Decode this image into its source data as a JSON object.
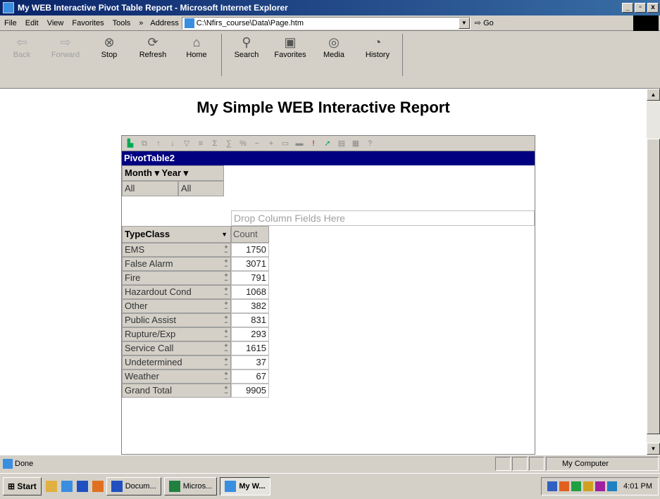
{
  "window": {
    "title": "My WEB Interactive Pivot Table Report - Microsoft Internet Explorer",
    "controls": [
      "_",
      "▫",
      "x"
    ]
  },
  "menu": {
    "items": [
      "File",
      "Edit",
      "View",
      "Favorites",
      "Tools"
    ],
    "more": "»",
    "address_label": "Address",
    "address_value": "C:\\Nfirs_course\\Data\\Page.htm",
    "go_label": "Go"
  },
  "toolbar": {
    "buttons": [
      {
        "label": "Back",
        "icon": "back-arrow-icon",
        "enabled": false
      },
      {
        "label": "Forward",
        "icon": "forward-arrow-icon",
        "enabled": false
      },
      {
        "label": "Stop",
        "icon": "stop-icon",
        "enabled": true
      },
      {
        "label": "Refresh",
        "icon": "refresh-icon",
        "enabled": true
      },
      {
        "label": "Home",
        "icon": "home-icon",
        "enabled": true
      },
      {
        "label": "Search",
        "icon": "search-icon",
        "enabled": true
      },
      {
        "label": "Favorites",
        "icon": "favorites-icon",
        "enabled": true
      },
      {
        "label": "Media",
        "icon": "media-icon",
        "enabled": true
      },
      {
        "label": "History",
        "icon": "history-icon",
        "enabled": true
      }
    ]
  },
  "page": {
    "title": "My Simple WEB Interactive Report"
  },
  "pivot": {
    "name": "PivotTable2",
    "filters": [
      {
        "field": "Month",
        "value": "All"
      },
      {
        "field": "Year",
        "value": "All"
      }
    ],
    "drop_column_hint": "Drop Column Fields Here",
    "row_field": "TypeClass",
    "data_field": "Count",
    "rows": [
      {
        "label": "EMS",
        "count": "1750"
      },
      {
        "label": "False Alarm",
        "count": "3071"
      },
      {
        "label": "Fire",
        "count": "791"
      },
      {
        "label": "Hazardout Cond",
        "count": "1068"
      },
      {
        "label": "Other",
        "count": "382"
      },
      {
        "label": "Public Assist",
        "count": "831"
      },
      {
        "label": "Rupture/Exp",
        "count": "293"
      },
      {
        "label": "Service Call",
        "count": "1615"
      },
      {
        "label": "Undetermined",
        "count": "37"
      },
      {
        "label": "Weather",
        "count": "67"
      },
      {
        "label": "Grand Total",
        "count": "9905"
      }
    ]
  },
  "status": {
    "text": "Done",
    "zone": "My Computer"
  },
  "taskbar": {
    "start": "Start",
    "tasks": [
      {
        "label": "Docum...",
        "active": false
      },
      {
        "label": "Micros...",
        "active": false
      },
      {
        "label": "My W...",
        "active": true
      }
    ],
    "clock": "4:01 PM"
  },
  "colors": {
    "title_gradient_start": "#0a246a",
    "pivot_title_bg": "#000080",
    "chrome": "#d4d0c8"
  }
}
